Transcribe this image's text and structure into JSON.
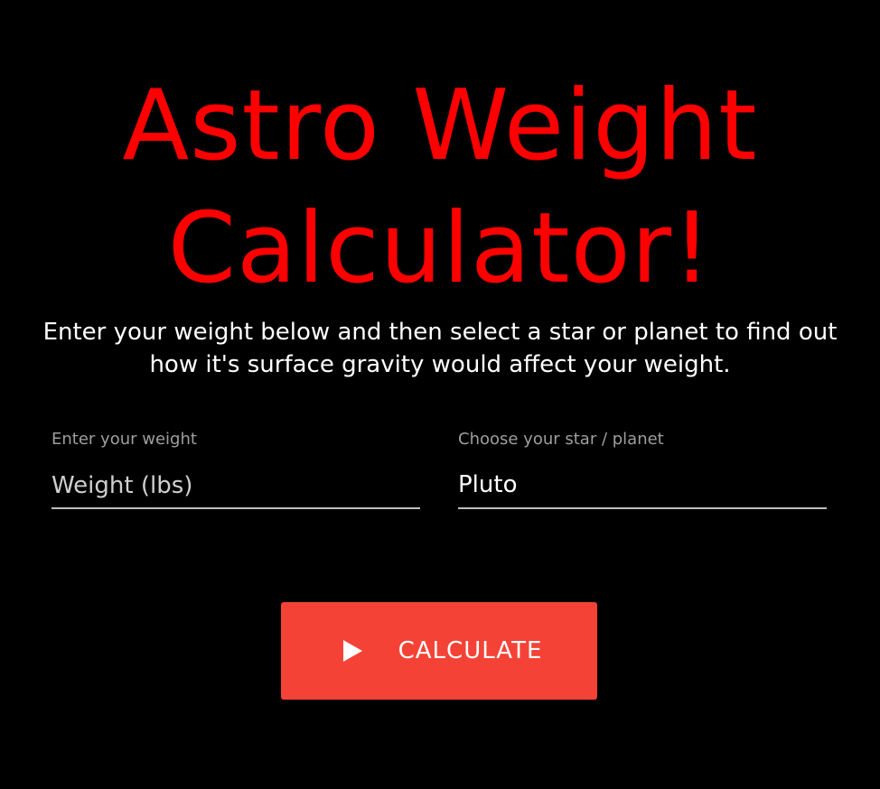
{
  "header": {
    "title_line1": "Astro Weight",
    "title_line2": "Calculator!",
    "subtitle": "Enter your weight below and then select a star or planet to find out how it's surface gravity would affect your weight."
  },
  "form": {
    "weight": {
      "label": "Enter your weight",
      "placeholder": "Weight (lbs)",
      "value": ""
    },
    "planet": {
      "label": "Choose your star / planet",
      "selected": "Pluto"
    },
    "calculate_button": {
      "label": "CALCULATE",
      "icon": "play-icon"
    }
  },
  "colors": {
    "background": "#000000",
    "title": "#ff0000",
    "button": "#f44336",
    "label": "#9e9e9e",
    "underline": "#bdbdbd"
  }
}
